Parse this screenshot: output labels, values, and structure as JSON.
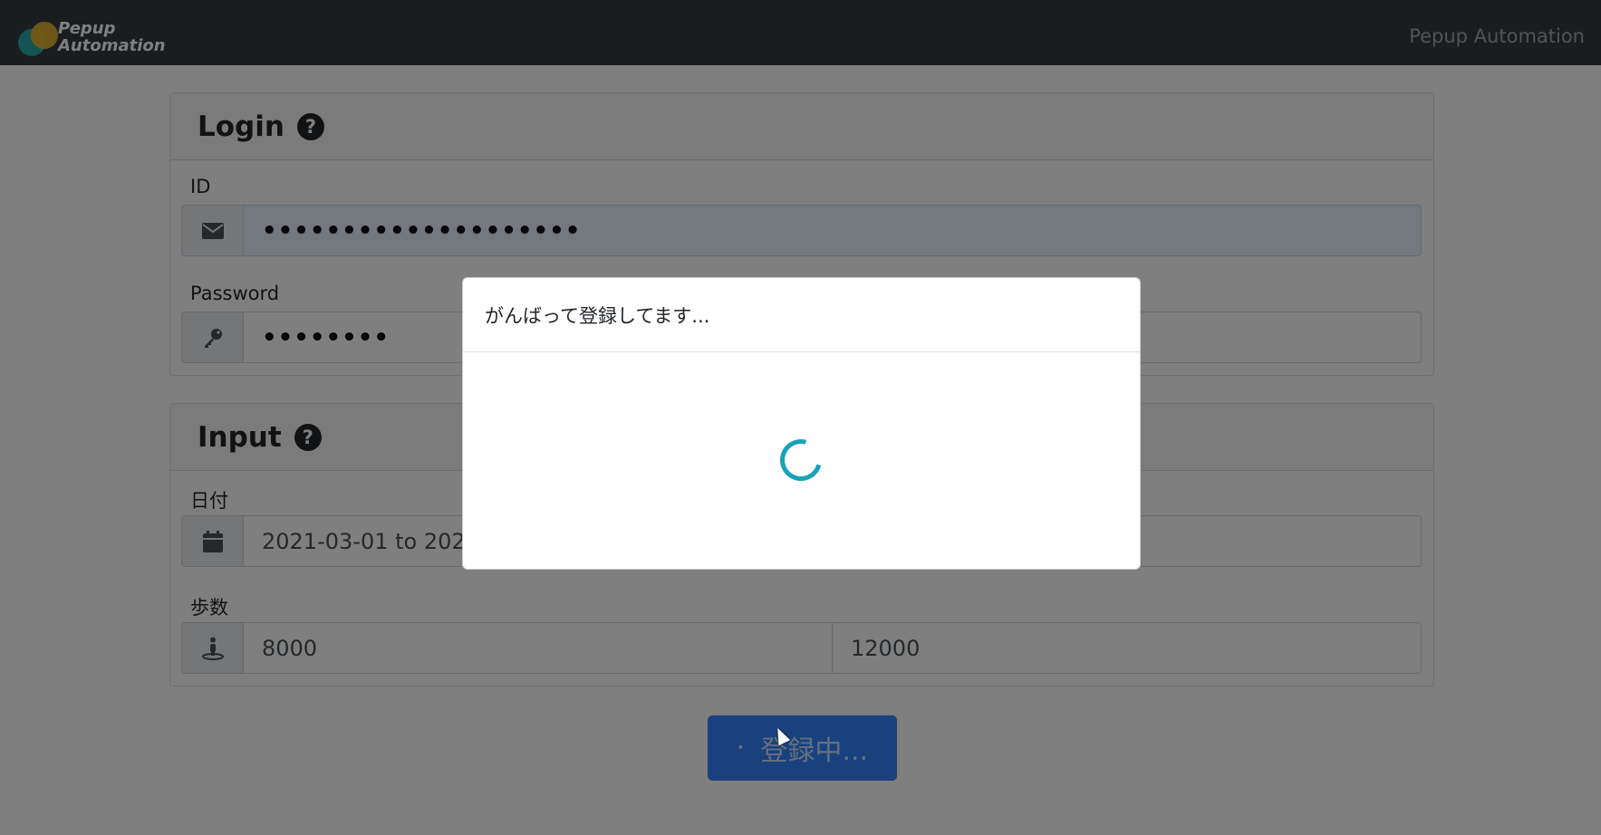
{
  "navbar": {
    "brand_line1": "Pepup",
    "brand_line2": "Automation",
    "right_text": "Pepup Automation"
  },
  "login_card": {
    "title": "Login",
    "help_icon": "question-circle-icon",
    "id_label": "ID",
    "id_icon": "envelope-icon",
    "id_value": "••••••••••••••••••••",
    "password_label": "Password",
    "password_icon": "key-icon",
    "password_value": "••••••••"
  },
  "input_card": {
    "title": "Input",
    "help_icon": "question-circle-icon",
    "date_label": "日付",
    "date_icon": "calendar-icon",
    "date_value": "2021-03-01 to 202",
    "steps_label": "歩数",
    "steps_icon": "walking-person-icon",
    "steps_min": "8000",
    "steps_max": "12000"
  },
  "submit_button": {
    "label": "登録中..."
  },
  "modal": {
    "title": "がんばって登録してます...",
    "spinner": "loading-spinner"
  },
  "colors": {
    "navbar": "#343a40",
    "primary": "#0d6efd",
    "spinner": "#17a2b8",
    "brand_teal": "#2aa9a8",
    "brand_yellow": "#e9b62d"
  }
}
